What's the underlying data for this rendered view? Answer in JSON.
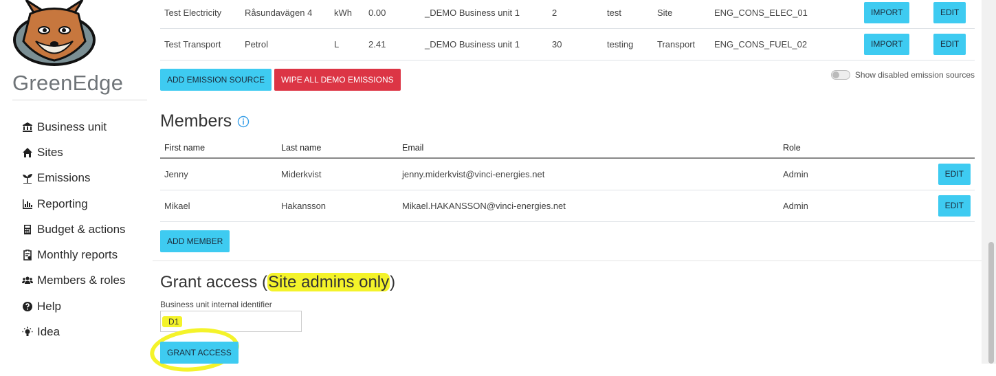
{
  "app": {
    "brand": "GreenEdge"
  },
  "sidebar": {
    "items": [
      {
        "label": "Business unit",
        "icon": "business-unit-icon"
      },
      {
        "label": "Sites",
        "icon": "home-icon"
      },
      {
        "label": "Emissions",
        "icon": "seedling-icon"
      },
      {
        "label": "Reporting",
        "icon": "bar-chart-icon"
      },
      {
        "label": "Budget & actions",
        "icon": "calculator-icon"
      },
      {
        "label": "Monthly reports",
        "icon": "clipboard-report-icon"
      },
      {
        "label": "Members & roles",
        "icon": "users-icon"
      },
      {
        "label": "Help",
        "icon": "question-circle-icon"
      },
      {
        "label": "Idea",
        "icon": "lightbulb-icon"
      }
    ]
  },
  "emissions": {
    "rows": [
      {
        "name": "Test Electricity",
        "source": "Råsundavägen 4",
        "unit": "kWh",
        "value": "0.00",
        "business_unit": "_DEMO Business unit 1",
        "number": "2",
        "note": "test",
        "type": "Site",
        "code": "ENG_CONS_ELEC_01"
      },
      {
        "name": "Test Transport",
        "source": "Petrol",
        "unit": "L",
        "value": "2.41",
        "business_unit": "_DEMO Business unit 1",
        "number": "30",
        "note": "testing",
        "type": "Transport",
        "code": "ENG_CONS_FUEL_02"
      }
    ],
    "import_label": "IMPORT",
    "edit_label": "EDIT",
    "add_label": "ADD EMISSION SOURCE",
    "wipe_label": "WIPE ALL DEMO EMISSIONS",
    "toggle_label": "Show disabled emission sources"
  },
  "members": {
    "title": "Members",
    "columns": {
      "first": "First name",
      "last": "Last name",
      "email": "Email",
      "role": "Role"
    },
    "rows": [
      {
        "first": "Jenny",
        "last": "Miderkvist",
        "email": "jenny.miderkvist@vinci-energies.net",
        "role": "Admin"
      },
      {
        "first": "Mikael",
        "last": "Hakansson",
        "email": "Mikael.HAKANSSON@vinci-energies.net",
        "role": "Admin"
      }
    ],
    "edit_label": "EDIT",
    "add_label": "ADD MEMBER"
  },
  "grant": {
    "title_prefix": "Grant access (",
    "title_highlight": "Site admins only",
    "title_suffix": ")",
    "field_label": "Business unit internal identifier",
    "field_value": "D1",
    "button_label": "GRANT ACCESS"
  },
  "colors": {
    "primary_button": "#3ecbf1",
    "danger_button": "#dc3545",
    "highlight": "#f4f32a",
    "info_icon": "#3aa0e8"
  }
}
